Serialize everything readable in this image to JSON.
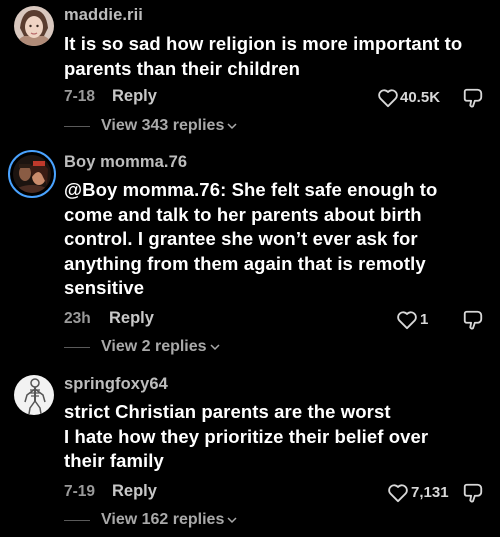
{
  "comments": [
    {
      "username": "maddie.rii",
      "text_lines": [
        "It is so sad how religion is more important to",
        "parents than their children"
      ],
      "time": "7-18",
      "reply_label": "Reply",
      "likes": "40.5K",
      "view_replies": "View 343 replies",
      "avatar_icon": "person-photo-avatar"
    },
    {
      "username": "Boy momma.76",
      "text_lines": [
        "@Boy momma.76: She felt safe enough to",
        "come and talk to her parents about birth",
        "control. I grantee she won’t ever ask for",
        "anything from them again that is remotly",
        "sensitive"
      ],
      "time": "23h",
      "reply_label": "Reply",
      "likes": "1",
      "view_replies": "View 2 replies",
      "avatar_icon": "couple-photo-avatar"
    },
    {
      "username": "springfoxy64",
      "text_lines": [
        "strict Christian parents are the worst",
        "I hate how they prioritize their belief over",
        "their family"
      ],
      "time": "7-19",
      "reply_label": "Reply",
      "likes": "7,131",
      "view_replies": "View 162 replies",
      "avatar_icon": "skeleton-figure-avatar"
    }
  ],
  "colors": {
    "background": "#000000",
    "text": "#ffffff",
    "muted": "#9a9a9a",
    "story_ring": "#4aa3ff"
  }
}
